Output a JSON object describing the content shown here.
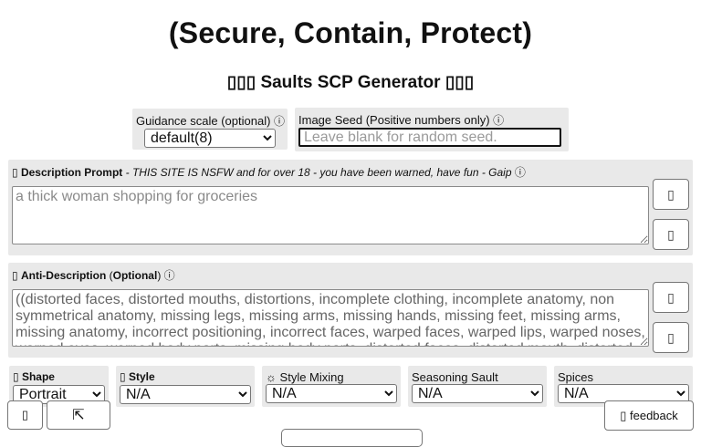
{
  "title": "(Secure, Contain, Protect)",
  "subtitle": "▯▯▯ Saults SCP Generator ▯▯▯",
  "guidance": {
    "label": "Guidance scale (optional)",
    "info_icon": "ⓘ",
    "selected": "default(8)"
  },
  "seed": {
    "label": "Image Seed (Positive numbers only)",
    "info_icon": "ⓘ",
    "placeholder": "Leave blank for random seed."
  },
  "description": {
    "icon": "▯",
    "label": "Description Prompt",
    "note": " - THIS SITE IS NSFW and for over 18 - you have been warned, have fun - Gaip",
    "info_icon": "ⓘ",
    "placeholder": "a thick woman shopping for groceries",
    "button1_icon": "▯",
    "button2_icon": "▯"
  },
  "anti_description": {
    "icon": "▯",
    "label_main": "Anti-Description",
    "label_paren_open": "(",
    "label_optional": "Optional",
    "label_paren_close": ")",
    "info_icon": "ⓘ",
    "value": "((distorted faces, distorted mouths, distortions, incomplete clothing, incomplete anatomy, non symmetrical anatomy, missing legs, missing arms, missing hands, missing feet, missing arms, missing anatomy, incorrect positioning, incorrect faces, warped faces, warped lips, warped noses, warped eyes, warped body parts, missing body parts, distorted faces, distorted mouth, distorted",
    "button1_icon": "▯",
    "button2_icon": "▯"
  },
  "shape": {
    "icon": "▯",
    "label": "Shape",
    "selected": "Portrait"
  },
  "style": {
    "icon": "▯",
    "label": "Style",
    "selected": "N/A"
  },
  "style_mixing": {
    "icon": "☼",
    "label": "Style Mixing",
    "selected": "N/A"
  },
  "seasoning": {
    "label": "Seasoning Sault",
    "selected": "N/A"
  },
  "spices": {
    "label": "Spices",
    "selected": "N/A"
  },
  "bottom": {
    "left_icon": "▯",
    "collapse_icon": "⇱",
    "feedback_icon": "▯",
    "feedback_label": "feedback"
  }
}
